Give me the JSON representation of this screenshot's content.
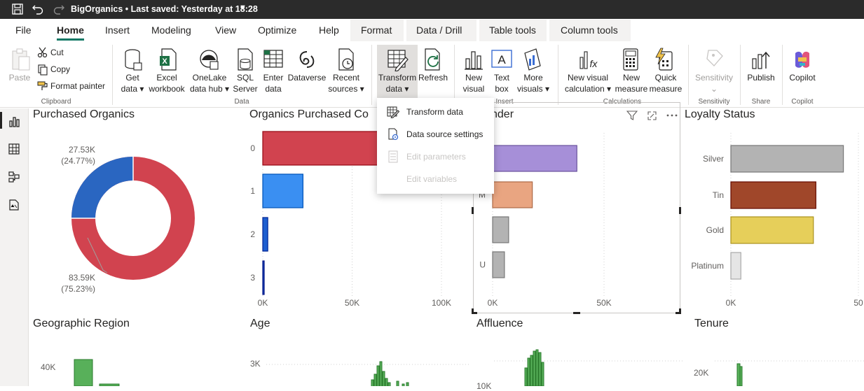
{
  "titlebar": {
    "title": "BigOrganics • Last saved: Yesterday at 18:28"
  },
  "menu": {
    "file": "File",
    "home": "Home",
    "insert": "Insert",
    "modeling": "Modeling",
    "view": "View",
    "optimize": "Optimize",
    "help": "Help",
    "format": "Format",
    "data_drill": "Data / Drill",
    "table_tools": "Table tools",
    "column_tools": "Column tools"
  },
  "ribbon": {
    "paste": "Paste",
    "cut": "Cut",
    "copy": "Copy",
    "format_painter": "Format painter",
    "clipboard": "Clipboard",
    "get_data_1": "Get",
    "get_data_2": "data",
    "excel_1": "Excel",
    "excel_2": "workbook",
    "onelake_1": "OneLake",
    "onelake_2": "data hub",
    "sql_1": "SQL",
    "sql_2": "Server",
    "enter_1": "Enter",
    "enter_2": "data",
    "dataverse": "Dataverse",
    "recent_1": "Recent",
    "recent_2": "sources",
    "data_group": "Data",
    "transform_1": "Transform",
    "transform_2": "data",
    "refresh": "Refresh",
    "new_visual_1": "New",
    "new_visual_2": "visual",
    "text_box_1": "Text",
    "text_box_2": "box",
    "more_visuals_1": "More",
    "more_visuals_2": "visuals",
    "insert_group": "Insert",
    "new_visual_calc_1": "New visual",
    "new_visual_calc_2": "calculation",
    "new_measure_1": "New",
    "new_measure_2": "measure",
    "quick_measure_1": "Quick",
    "quick_measure_2": "measure",
    "calculations_group": "Calculations",
    "sensitivity": "Sensitivity",
    "sensitivity_group": "Sensitivity",
    "publish": "Publish",
    "share_group": "Share",
    "copilot": "Copilot",
    "copilot_group": "Copilot"
  },
  "dropdown": {
    "transform_data": "Transform data",
    "data_source_settings": "Data source settings",
    "edit_parameters": "Edit parameters",
    "edit_variables": "Edit variables"
  },
  "visuals": {
    "purchased_organics": {
      "title": "Purchased Organics",
      "label_small_1": "27.53K",
      "label_small_2": "(24.77%)",
      "label_large_1": "83.59K",
      "label_large_2": "(75.23%)"
    },
    "organics_purchased_count": {
      "title": "Organics Purchased Co",
      "ticks": [
        "0K",
        "50K",
        "100K"
      ]
    },
    "gender": {
      "title": "nder",
      "ticks": [
        "0K",
        "50K"
      ]
    },
    "loyalty_status": {
      "title": "Loyalty Status",
      "ticks": [
        "0K",
        "50"
      ]
    },
    "geographic_region": {
      "title": "Geographic Region",
      "ytick": "40K"
    },
    "age": {
      "title": "Age",
      "ytick": "3K"
    },
    "affluence": {
      "title": "Affluence",
      "ytick": "10K"
    },
    "tenure": {
      "title": "Tenure",
      "ytick": "20K"
    }
  },
  "chart_data": [
    {
      "type": "pie",
      "title": "Purchased Organics",
      "categories": [
        "0",
        "1"
      ],
      "values": [
        83590,
        27530
      ],
      "percent": [
        75.23,
        24.77
      ],
      "colors": [
        "#d1434f",
        "#2a66c1"
      ]
    },
    {
      "type": "bar",
      "title": "Organics Purchased Co",
      "categories": [
        "0",
        "1",
        "2",
        "3"
      ],
      "values": [
        70000,
        22500,
        2800,
        500
      ],
      "xlim": [
        0,
        100000
      ],
      "colors": [
        "#d1434f",
        "#3a8ff2",
        "#1e5fd0",
        "#1a4ec0"
      ]
    },
    {
      "type": "bar",
      "title": "nder",
      "categories": [
        "F",
        "M",
        "",
        "U"
      ],
      "values": [
        60500,
        28500,
        11500,
        8500
      ],
      "xlim": [
        0,
        80000
      ],
      "colors": [
        "#a68fd8",
        "#e9a581",
        "#b3b3b3",
        "#b3b3b3"
      ]
    },
    {
      "type": "bar",
      "title": "Loyalty Status",
      "categories": [
        "Silver",
        "Tin",
        "Gold",
        "Platinum"
      ],
      "values": [
        45000,
        34000,
        33000,
        4000
      ],
      "xlim": [
        0,
        51000
      ],
      "colors": [
        "#b3b3b3",
        "#a0472a",
        "#e6cf5a",
        "#e5e5e5"
      ]
    }
  ]
}
